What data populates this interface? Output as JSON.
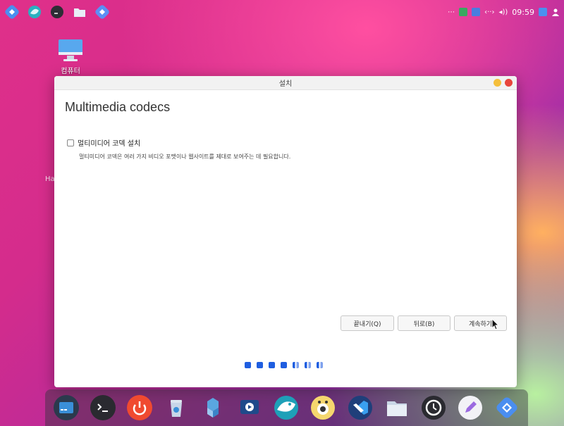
{
  "desktop": {
    "icon_label": "컴퓨터",
    "partial_text": "Ha"
  },
  "top_panel": {
    "overflow": "⋯",
    "clock": "09:59",
    "network_symbol": "‹··›",
    "volume_symbol": "◂))"
  },
  "window": {
    "title": "설치",
    "heading": "Multimedia codecs",
    "checkbox_label": "멀티미디어 코덱 설치",
    "checkbox_checked": false,
    "description": "멀티미디어 코덱은 여러 가지 비디오 포맷이나 웹사이트를 제대로 보여주는 데 필요합니다.",
    "buttons": {
      "quit": "끝내기(Q)",
      "back": "뒤로(B)",
      "continue": "계속하기"
    },
    "progress": {
      "completed_steps": 4,
      "total_steps": 7
    }
  },
  "colors": {
    "accent_blue": "#1f5ee0",
    "close_red": "#e8453c",
    "minimize_yellow": "#f5bf3b"
  },
  "dock_icons": [
    "file-manager-icon",
    "terminal-icon",
    "power-icon",
    "trash-icon",
    "package-icon",
    "video-icon",
    "browser-icon",
    "media-player-icon",
    "vscode-icon",
    "folder-icon",
    "clock-icon",
    "text-editor-icon",
    "installer-icon"
  ]
}
